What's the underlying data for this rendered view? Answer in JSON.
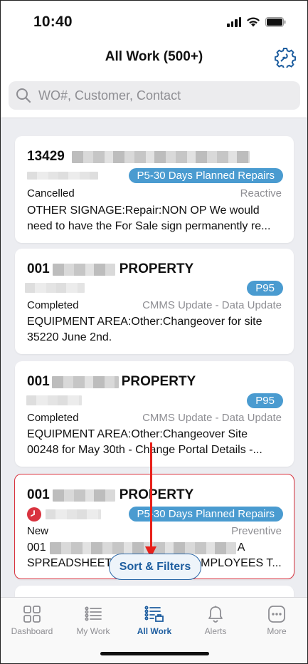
{
  "status_bar": {
    "time": "10:40"
  },
  "header": {
    "title": "All Work (500+)"
  },
  "search": {
    "placeholder": "WO#, Customer, Contact"
  },
  "work_orders": [
    {
      "number": "13429",
      "priority": "P5-30 Days Planned Repairs",
      "status": "Cancelled",
      "type": "Reactive",
      "description_line1": "OTHER SIGNAGE:Repair:NON OP We would",
      "description_line2": "need to have the For Sale sign permanently re..."
    },
    {
      "number": "001",
      "name_suffix": "PROPERTY",
      "priority": "P95",
      "status": "Completed",
      "type": "CMMS Update - Data Update",
      "description_line1": "EQUIPMENT AREA:Other:Changeover for site",
      "description_line2": "35220 June 2nd."
    },
    {
      "number": "001",
      "name_suffix": "PROPERTY",
      "priority": "P95",
      "status": "Completed",
      "type": "CMMS Update - Data Update",
      "description_line1": "EQUIPMENT AREA:Other:Changeover Site",
      "description_line2": "00248 for May 30th - Change Portal Details -..."
    },
    {
      "number": "001",
      "name_suffix": "PROPERTY",
      "priority": "P5-30 Days Planned Repairs",
      "status": "New",
      "type": "Preventive",
      "description_line1_start": "001",
      "description_line1_end": "A",
      "description_line2_start": "SPREADSHEET",
      "description_line2_end": "MPLOYEES T..."
    }
  ],
  "sort_button": {
    "label": "Sort & Filters"
  },
  "tabs": [
    {
      "label": "Dashboard",
      "icon": "dashboard-icon"
    },
    {
      "label": "My Work",
      "icon": "list-icon"
    },
    {
      "label": "All Work",
      "icon": "all-work-icon",
      "active": true
    },
    {
      "label": "Alerts",
      "icon": "bell-icon"
    },
    {
      "label": "More",
      "icon": "more-icon"
    }
  ],
  "colors": {
    "accent": "#1d5d9f",
    "badge": "#4a9bd0",
    "overdue": "#d9333f",
    "annotation_arrow": "#e8211b"
  }
}
